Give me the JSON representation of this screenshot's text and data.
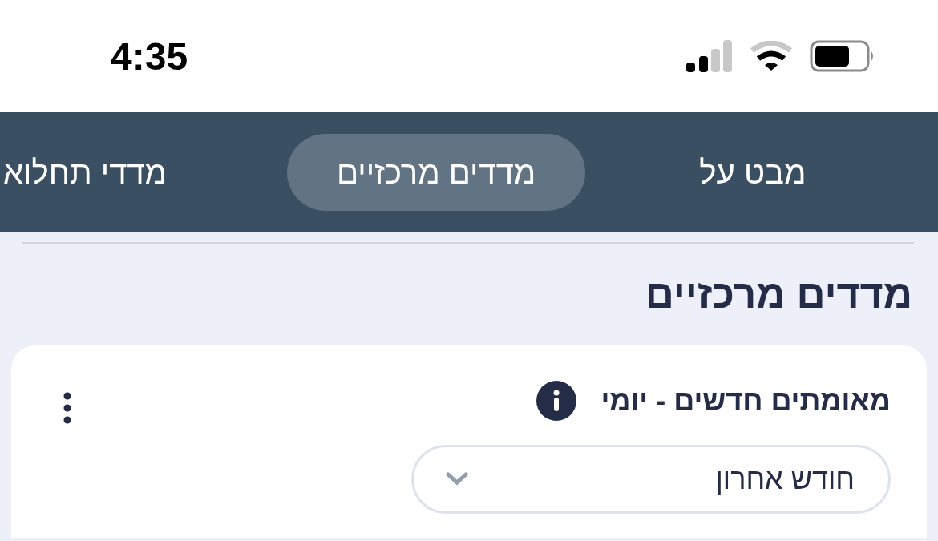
{
  "status_bar": {
    "time": "4:35"
  },
  "tabs": [
    {
      "label": "מבט על",
      "selected": false
    },
    {
      "label": "מדדים מרכזיים",
      "selected": true
    },
    {
      "label": "מדדי תחלוא",
      "selected": false
    }
  ],
  "heading": "מדדים מרכזיים",
  "card": {
    "title": "מאומתים חדשים - יומי",
    "dropdown": {
      "value": "חודש אחרון"
    }
  }
}
